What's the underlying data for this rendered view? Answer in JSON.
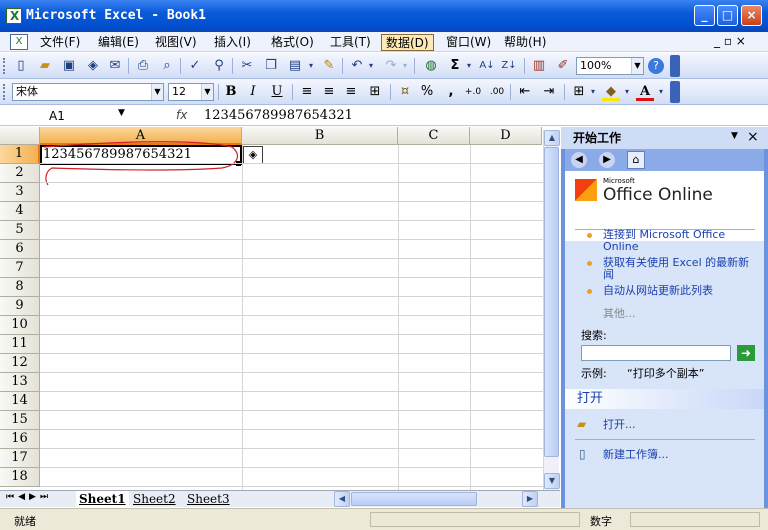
{
  "window": {
    "title": "Microsoft Excel - Book1",
    "minimize": "_",
    "maximize": "□",
    "close": "×"
  },
  "menu": {
    "items": [
      "文件(F)",
      "编辑(E)",
      "视图(V)",
      "插入(I)",
      "格式(O)",
      "工具(T)",
      "数据(D)",
      "窗口(W)",
      "帮助(H)"
    ],
    "selected": "数据(D)",
    "doc_controls": "_ ▫ ×"
  },
  "toolbar": {
    "zoom": "100%",
    "font_name": "宋体",
    "font_size": "12",
    "bold": "B",
    "italic": "I",
    "underline": "U",
    "percent": "%",
    "comma": ","
  },
  "formula_bar": {
    "name_box": "A1",
    "fx": "fx",
    "value": "123456789987654321"
  },
  "sheet": {
    "columns": [
      "A",
      "B",
      "C",
      "D"
    ],
    "rows": [
      "1",
      "2",
      "3",
      "4",
      "5",
      "6",
      "7",
      "8",
      "9",
      "10",
      "11",
      "12",
      "13",
      "14",
      "15",
      "16",
      "17",
      "18"
    ],
    "cell_a1": "123456789987654321"
  },
  "sheet_tabs": [
    "Sheet1",
    "Sheet2",
    "Sheet3"
  ],
  "statusbar": {
    "left": "就绪",
    "mode": "数字"
  },
  "taskpane": {
    "title": "开始工作",
    "office_online_small": "Microsoft",
    "office_online": "Office Online",
    "links": [
      "连接到 Microsoft Office Online",
      "获取有关使用 Excel 的最新新闻",
      "自动从网站更新此列表"
    ],
    "more": "其他...",
    "search_label": "搜索:",
    "search_example_label": "示例:",
    "search_example": "“打印多个副本”",
    "open_section": "打开",
    "open_link": "打开...",
    "new_workbook": "新建工作簿..."
  },
  "colors": {
    "title_blue": "#0a5ad8",
    "selection_orange": "#f4b050",
    "annotation_red": "#d0202a"
  }
}
